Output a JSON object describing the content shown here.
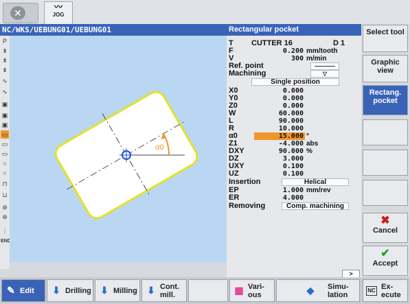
{
  "top": {
    "mode_icon": "close-circle-icon",
    "jog_label": "JOG"
  },
  "path": "NC/WKS/UEBUNG01/UEBUNG01",
  "cycle": {
    "title": "Rectangular pocket"
  },
  "canvas": {
    "angle_label": "α0"
  },
  "params": {
    "T": {
      "label": "T",
      "value": "CUTTER 16",
      "extra": "D 1"
    },
    "F": {
      "label": "F",
      "value": "0.200",
      "unit": "mm/tooth"
    },
    "V": {
      "label": "V",
      "value": "300",
      "unit": "m/min"
    },
    "ref": {
      "label": "Ref. point"
    },
    "machining": {
      "label": "Machining"
    },
    "position": {
      "value": "Single position"
    },
    "X0": {
      "label": "X0",
      "value": "0.000"
    },
    "Y0": {
      "label": "Y0",
      "value": "0.000"
    },
    "Z0": {
      "label": "Z0",
      "value": "0.000"
    },
    "W": {
      "label": "W",
      "value": "60.000"
    },
    "L": {
      "label": "L",
      "value": "90.000"
    },
    "R": {
      "label": "R",
      "value": "10.000"
    },
    "a0": {
      "label": "α0",
      "value": "15.000",
      "unit": "°"
    },
    "Z1": {
      "label": "Z1",
      "value": "-4.000",
      "unit": "abs"
    },
    "DXY": {
      "label": "DXY",
      "value": "90.000",
      "unit": "%"
    },
    "DZ": {
      "label": "DZ",
      "value": "3.000"
    },
    "UXY": {
      "label": "UXY",
      "value": "0.100"
    },
    "UZ": {
      "label": "UZ",
      "value": "0.100"
    },
    "insertion": {
      "label": "Insertion",
      "value": "Helical"
    },
    "EP": {
      "label": "EP",
      "value": "1.000",
      "unit": "mm/rev"
    },
    "ER": {
      "label": "ER",
      "value": "4.000"
    },
    "removing": {
      "label": "Removing",
      "value": "Comp. machining"
    },
    "more": ">"
  },
  "softkeys": {
    "select_tool": "Select tool",
    "graphic_view": "Graphic view",
    "rectang_pocket": "Rectang. pocket",
    "cancel": "Cancel",
    "accept": "Accept"
  },
  "hkeys": {
    "edit": "Edit",
    "drilling": "Drilling",
    "milling": "Milling",
    "cont_mill_1": "Cont.",
    "cont_mill_2": "mill.",
    "various_1": "Vari-",
    "various_2": "ous",
    "simulation_1": "Simu-",
    "simulation_2": "lation",
    "execute_1": "Ex-",
    "execute_2": "ecute",
    "nc_badge": "NC"
  },
  "colors": {
    "accent": "#3a63b7",
    "highlight": "#f0952a",
    "canvas": "#b9d7f2",
    "pocket_edge": "#e5e02a"
  }
}
